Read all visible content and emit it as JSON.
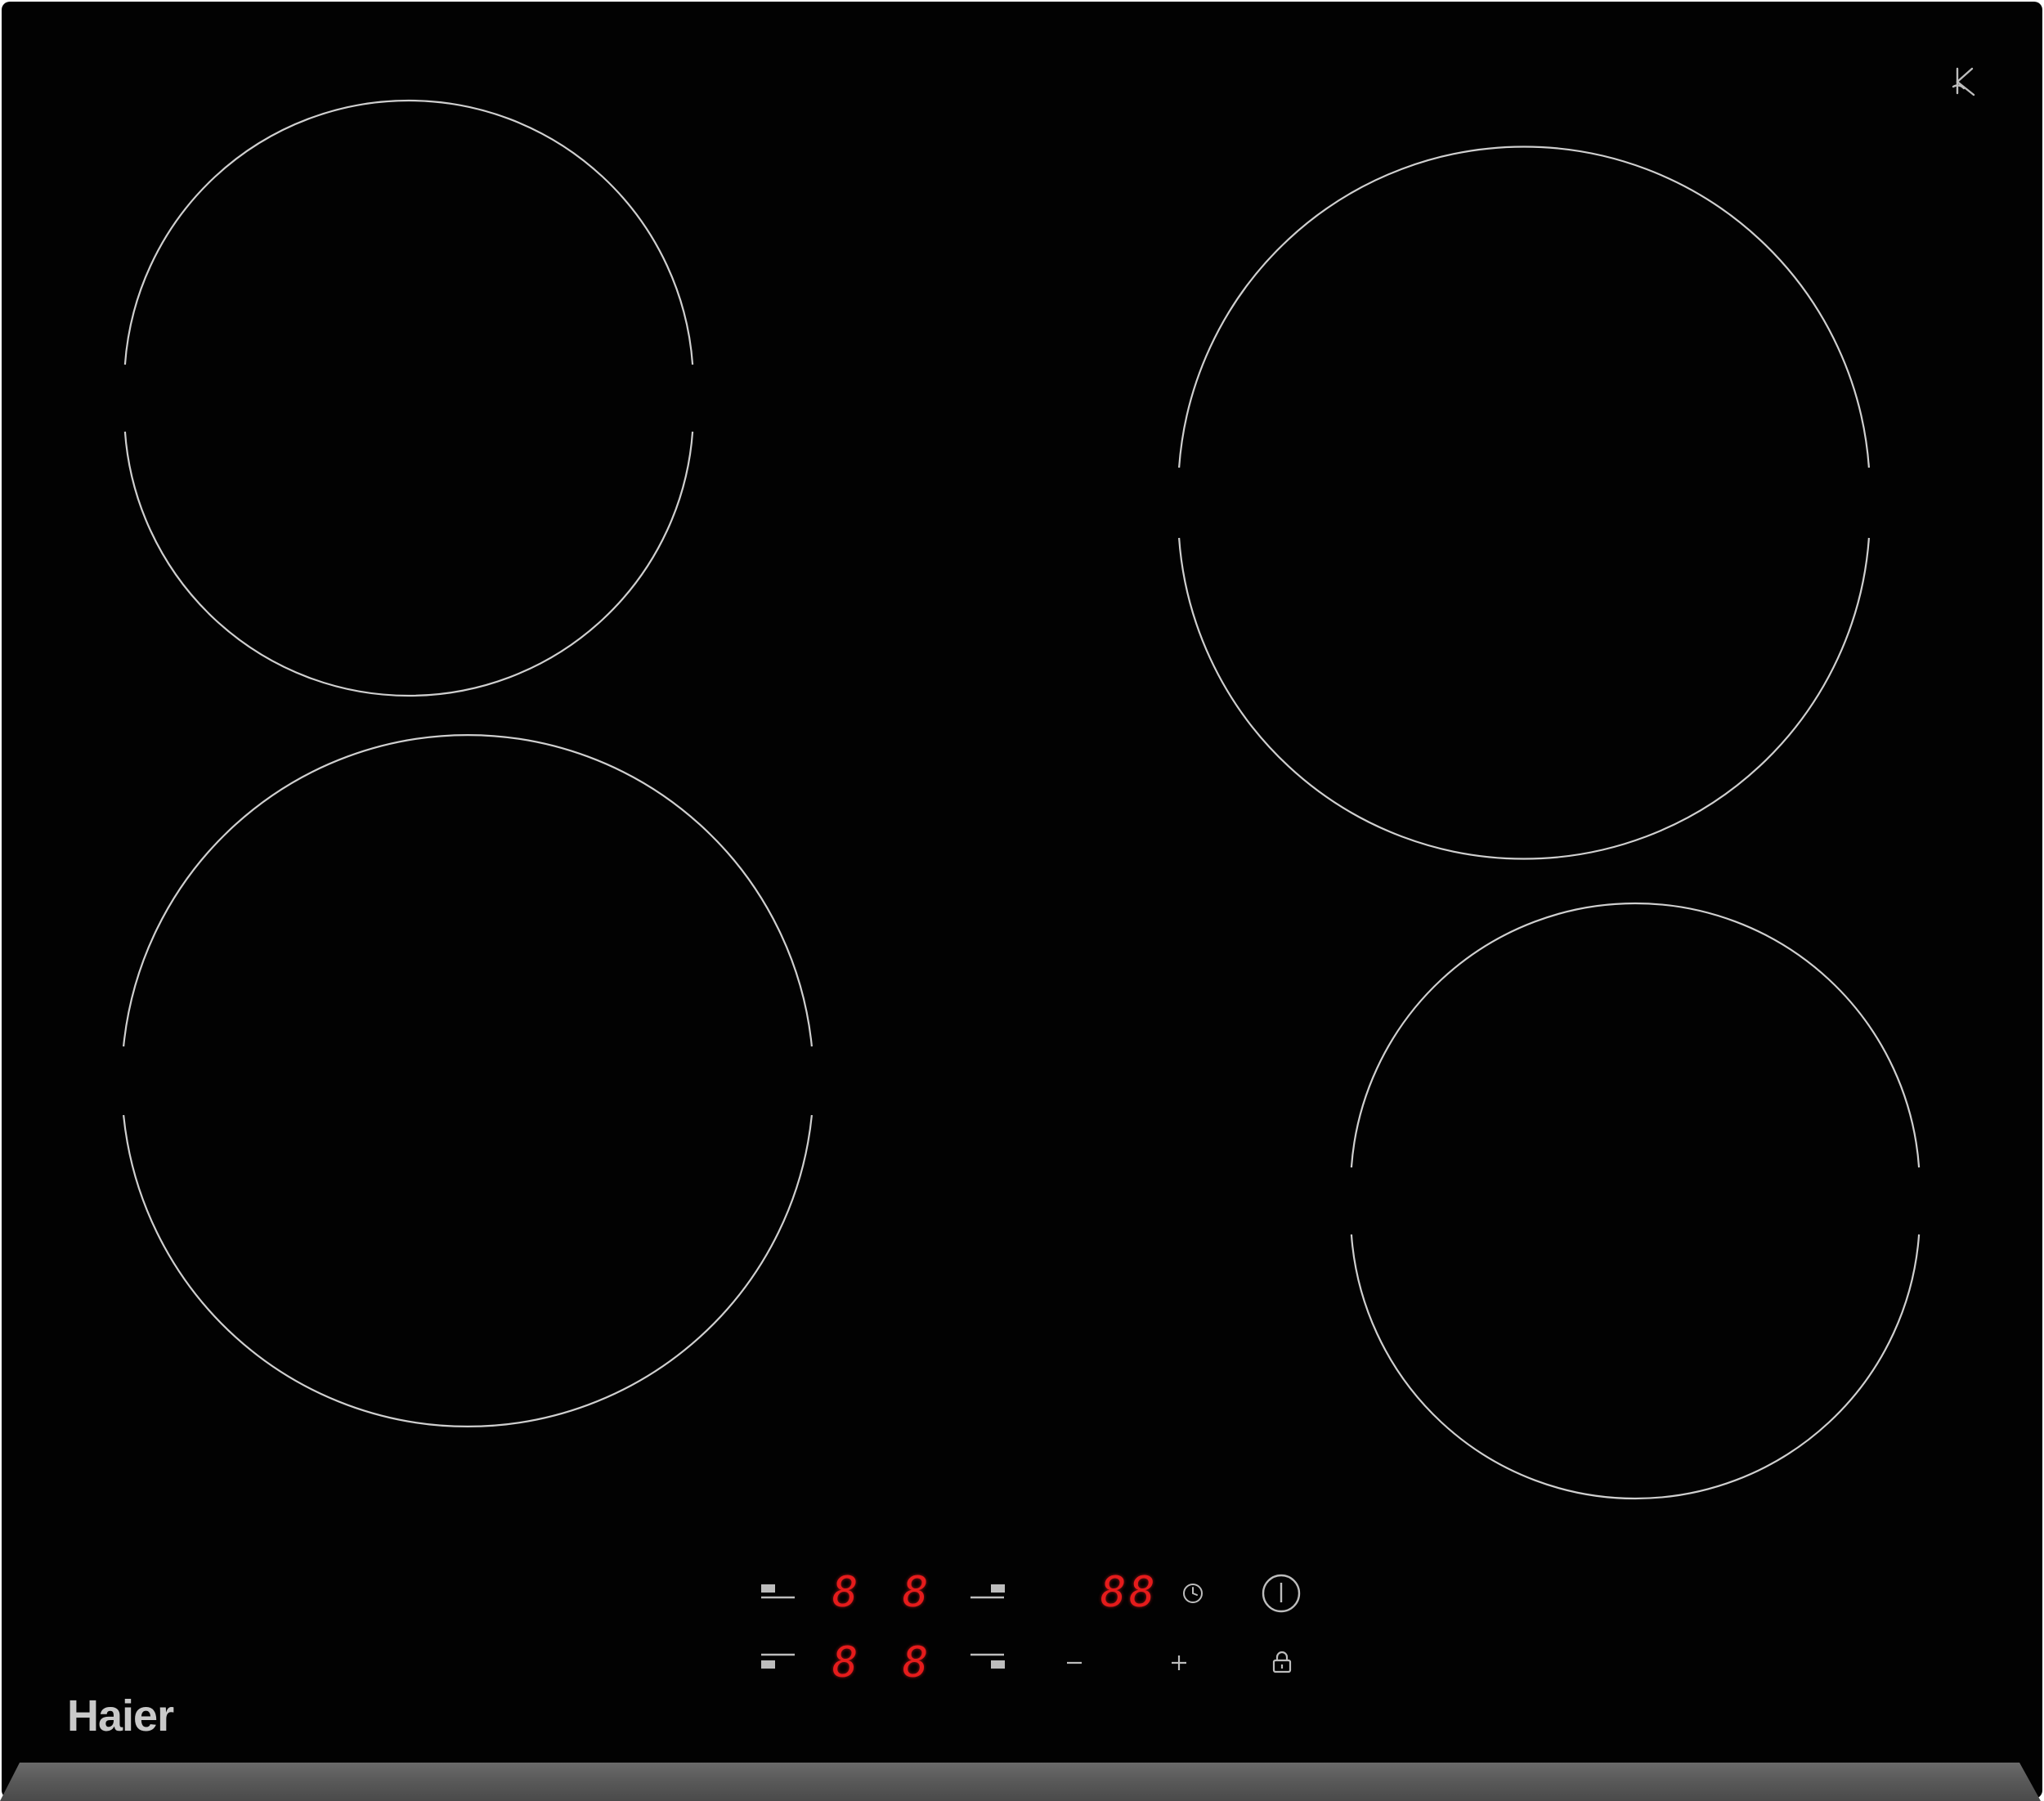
{
  "brand": {
    "name": "Haier"
  },
  "cooking_zones": [
    {
      "id": "rear-left",
      "shape": "circle-with-gaps"
    },
    {
      "id": "front-left",
      "shape": "circle-with-gaps"
    },
    {
      "id": "rear-right",
      "shape": "circle-with-gaps"
    },
    {
      "id": "front-right",
      "shape": "circle-with-gaps"
    }
  ],
  "control_panel": {
    "zone_displays": {
      "rear_left": "8",
      "rear_right": "8",
      "front_left": "8",
      "front_right": "8"
    },
    "timer_display": "88",
    "icons": {
      "rear_left_zone": "zone-rear-left-icon",
      "rear_right_zone": "zone-rear-right-icon",
      "front_left_zone": "zone-front-left-icon",
      "front_right_zone": "zone-front-right-icon",
      "timer": "clock-icon",
      "power": "power-icon",
      "minus": "minus-icon",
      "plus": "plus-icon",
      "lock": "lock-icon"
    },
    "display_color": "#e51b1b",
    "symbol_color": "#bdbdbd"
  },
  "colors": {
    "glass": "#020202",
    "zone_outline": "#cfcfcf",
    "edge": "#5a5a5a",
    "logo": "#c9c9c9"
  }
}
